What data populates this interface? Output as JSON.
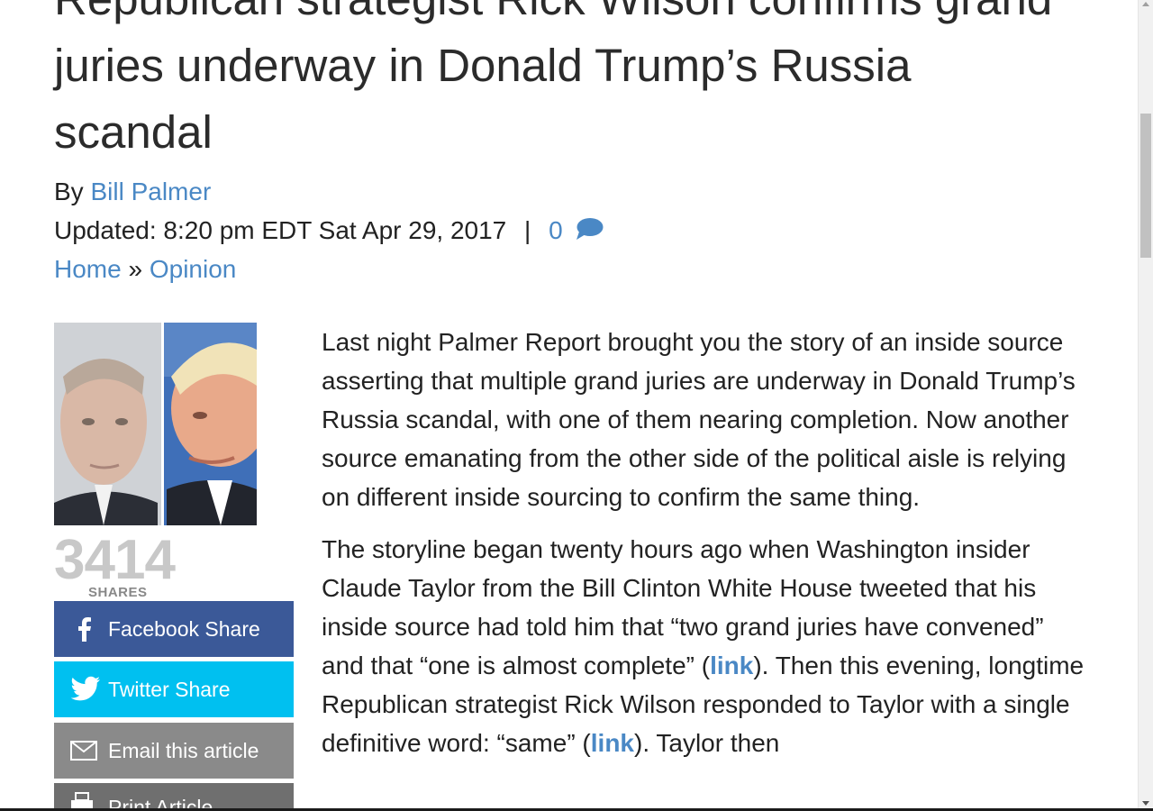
{
  "article": {
    "title": "Republican strategist Rick Wilson confirms grand juries underway in Donald Trump’s Russia scandal",
    "by_prefix": "By",
    "author": "Bill Palmer",
    "updated_label": "Updated: 8:20 pm EDT Sat Apr 29, 2017",
    "separator": "|",
    "comment_count": "0",
    "breadcrumb": {
      "home": "Home",
      "sep": "»",
      "section": "Opinion"
    },
    "paragraphs": [
      {
        "text": "Last night Palmer Report brought you the story of an inside source asserting that multiple grand juries are underway in Donald Trump’s Russia scandal, with one of them nearing completion. Now another source emanating from the other side of the political aisle is relying on different inside sourcing to confirm the same thing."
      },
      {
        "a": "The storyline began twenty hours ago when Washington insider Claude Taylor from the Bill Clinton White House tweeted that his inside source had told him that “two grand juries have convened” and that “one is almost complete” (",
        "link1": "link",
        "b": "). Then this evening, longtime Republican strategist Rick Wilson responded to Taylor with a single definitive word: “same” (",
        "link2": "link",
        "c": "). Taylor then"
      }
    ]
  },
  "share": {
    "count": "3414",
    "label": "SHARES",
    "buttons": {
      "facebook": "Facebook Share",
      "twitter": "Twitter Share",
      "email": "Email this article",
      "print": "Print Article"
    }
  },
  "icons": {
    "comment": "comment-bubble-icon",
    "facebook": "facebook-icon",
    "twitter": "twitter-icon",
    "email": "envelope-icon",
    "print": "printer-icon"
  },
  "colors": {
    "link": "#4a88c5",
    "facebook": "#3b5998",
    "twitter": "#00c0f0",
    "email": "#8a8a8a",
    "print": "#6f6f6f",
    "shares_count": "#c8c8c8"
  }
}
